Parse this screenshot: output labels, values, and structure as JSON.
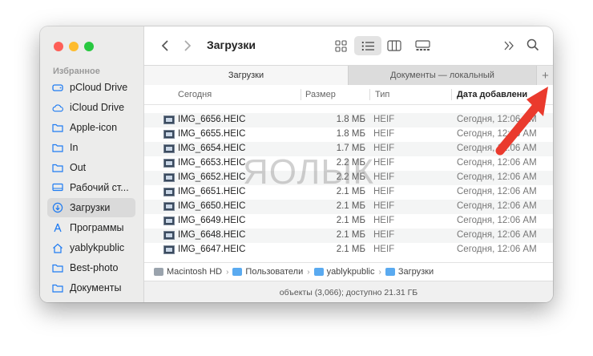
{
  "window": {
    "title": "Загрузки"
  },
  "sidebar": {
    "section_title": "Избранное",
    "items": [
      {
        "label": "pCloud Drive",
        "icon": "drive-icon"
      },
      {
        "label": "iCloud Drive",
        "icon": "cloud-icon"
      },
      {
        "label": "Apple-icon",
        "icon": "folder-icon"
      },
      {
        "label": "In",
        "icon": "folder-icon"
      },
      {
        "label": "Out",
        "icon": "folder-icon"
      },
      {
        "label": "Рабочий ст...",
        "icon": "desktop-icon"
      },
      {
        "label": "Загрузки",
        "icon": "download-icon",
        "selected": true
      },
      {
        "label": "Программы",
        "icon": "apps-icon"
      },
      {
        "label": "yablykpublic",
        "icon": "home-icon"
      },
      {
        "label": "Best-photo",
        "icon": "folder-icon"
      },
      {
        "label": "Документы",
        "icon": "folder-icon"
      }
    ]
  },
  "tabs": {
    "active": "Загрузки",
    "inactive": "Документы — локальный",
    "add": "+"
  },
  "columns": {
    "name": "Сегодня",
    "size": "Размер",
    "type": "Тип",
    "date": "Дата добавлени"
  },
  "files": [
    {
      "name": "IMG_6656.HEIC",
      "size": "1.8 МБ",
      "type": "HEIF",
      "date": "Сегодня, 12:06 AM"
    },
    {
      "name": "IMG_6655.HEIC",
      "size": "1.8 МБ",
      "type": "HEIF",
      "date": "Сегодня, 12:06 AM"
    },
    {
      "name": "IMG_6654.HEIC",
      "size": "1.7 МБ",
      "type": "HEIF",
      "date": "Сегодня, 12:06 AM"
    },
    {
      "name": "IMG_6653.HEIC",
      "size": "2.2 МБ",
      "type": "HEIF",
      "date": "Сегодня, 12:06 AM"
    },
    {
      "name": "IMG_6652.HEIC",
      "size": "2.2 МБ",
      "type": "HEIF",
      "date": "Сегодня, 12:06 AM"
    },
    {
      "name": "IMG_6651.HEIC",
      "size": "2.1 МБ",
      "type": "HEIF",
      "date": "Сегодня, 12:06 AM"
    },
    {
      "name": "IMG_6650.HEIC",
      "size": "2.1 МБ",
      "type": "HEIF",
      "date": "Сегодня, 12:06 AM"
    },
    {
      "name": "IMG_6649.HEIC",
      "size": "2.1 МБ",
      "type": "HEIF",
      "date": "Сегодня, 12:06 AM"
    },
    {
      "name": "IMG_6648.HEIC",
      "size": "2.1 МБ",
      "type": "HEIF",
      "date": "Сегодня, 12:06 AM"
    },
    {
      "name": "IMG_6647.HEIC",
      "size": "2.1 МБ",
      "type": "HEIF",
      "date": "Сегодня, 12:06 AM"
    }
  ],
  "pathbar": [
    "Macintosh HD",
    "Пользователи",
    "yablykpublic",
    "Загрузки"
  ],
  "status": "объекты (3,066); доступно 21.31 ГБ",
  "watermark": "ЯОЛЫК",
  "colors": {
    "accent": "#1e7bf2",
    "arrow": "#ea3a2d"
  }
}
